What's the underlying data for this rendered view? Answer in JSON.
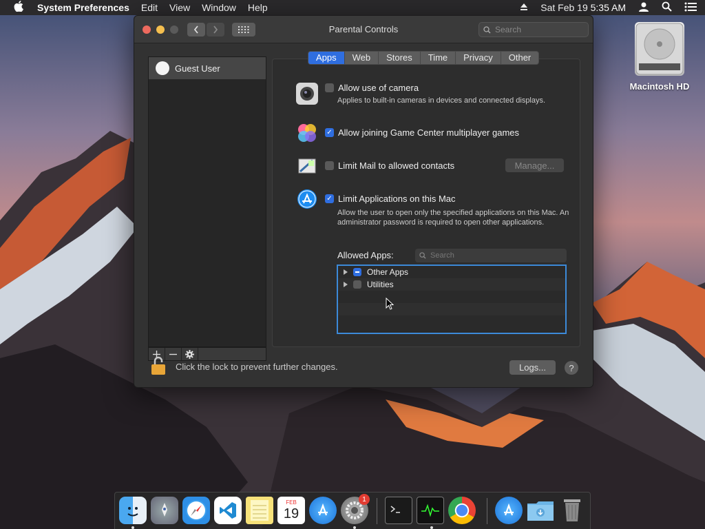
{
  "menubar": {
    "app": "System Preferences",
    "items": [
      "Edit",
      "View",
      "Window",
      "Help"
    ],
    "clock": "Sat Feb 19  5:35 AM"
  },
  "window": {
    "title": "Parental Controls",
    "search_placeholder": "Search"
  },
  "sidebar": {
    "users": [
      {
        "name": "Guest User"
      }
    ]
  },
  "tabs": [
    "Apps",
    "Web",
    "Stores",
    "Time",
    "Privacy",
    "Other"
  ],
  "active_tab": "Apps",
  "options": {
    "camera": {
      "label": "Allow use of camera",
      "desc": "Applies to built-in cameras in devices and connected displays.",
      "checked": false
    },
    "gamecenter": {
      "label": "Allow joining Game Center multiplayer games",
      "checked": true
    },
    "mail": {
      "label": "Limit Mail to allowed contacts",
      "checked": false,
      "button": "Manage..."
    },
    "apps": {
      "label": "Limit Applications on this Mac",
      "checked": true,
      "desc": "Allow the user to open only the specified applications on this Mac. An administrator password is required to open other applications."
    }
  },
  "allowed_apps": {
    "label": "Allowed Apps:",
    "search_placeholder": "Search",
    "items": [
      {
        "name": "Other Apps",
        "state": "mixed"
      },
      {
        "name": "Utilities",
        "state": "unchecked"
      }
    ]
  },
  "footer": {
    "lock_text": "Click the lock to prevent further changes.",
    "logs_button": "Logs...",
    "help": "?"
  },
  "desktop": {
    "disk_label": "Macintosh HD"
  },
  "dock": {
    "calendar_month": "FEB",
    "calendar_day": "19",
    "sysprefs_badge": "1"
  }
}
